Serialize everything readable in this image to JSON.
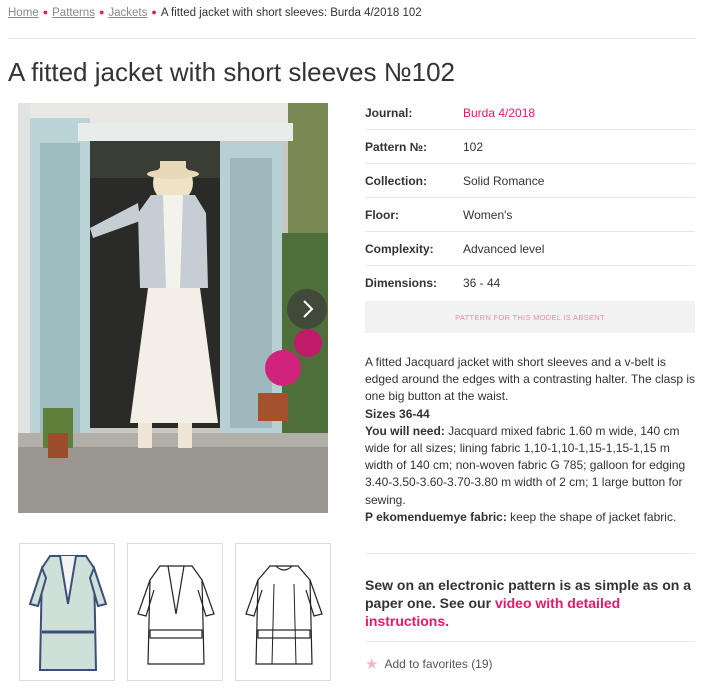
{
  "breadcrumb": {
    "items": [
      "Home",
      "Patterns",
      "Jackets"
    ],
    "current": "A fitted jacket with short sleeves: Burda 4/2018 102"
  },
  "title": "A fitted jacket with short sleeves №102",
  "specs": {
    "journal_label": "Journal:",
    "journal_value": "Burda 4/2018",
    "pattern_label": "Pattern №:",
    "pattern_value": "102",
    "collection_label": "Collection:",
    "collection_value": "Solid Romance",
    "floor_label": "Floor:",
    "floor_value": "Women's",
    "complexity_label": "Complexity:",
    "complexity_value": "Advanced level",
    "dimensions_label": "Dimensions:",
    "dimensions_value": "36 - 44"
  },
  "absent_button": "PATTERN FOR THIS MODEL IS ABSENT",
  "description": {
    "intro": "A fitted Jacquard jacket with short sleeves and a v-belt is edged around the edges with a contrasting halter. The clasp is one big button at the waist.",
    "sizes": "Sizes 36-44",
    "need_label": "You will need:",
    "need_text": " Jacquard mixed fabric 1.60 m wide, 140 cm wide for all sizes; lining fabric 1,10-1,10-1,15-1,15-1,15 m width of 140 cm; non-woven fabric G 785; galloon for edging 3.40-3.50-3.60-3.70-3.80 m width of 2 cm; 1 large button for sewing.",
    "rec_label": "P ekomenduemye fabric:",
    "rec_text": " keep the shape of jacket fabric."
  },
  "promo": {
    "text": "Sew on an electronic pattern is as simple as on a paper one. See our ",
    "link": "video with detailed instructions."
  },
  "favorites": {
    "label": "Add to favorites",
    "count": "(19)"
  },
  "colors": {
    "accent": "#e5186a",
    "muted_button_text": "#f08aa6",
    "border": "#e6e6e6"
  }
}
